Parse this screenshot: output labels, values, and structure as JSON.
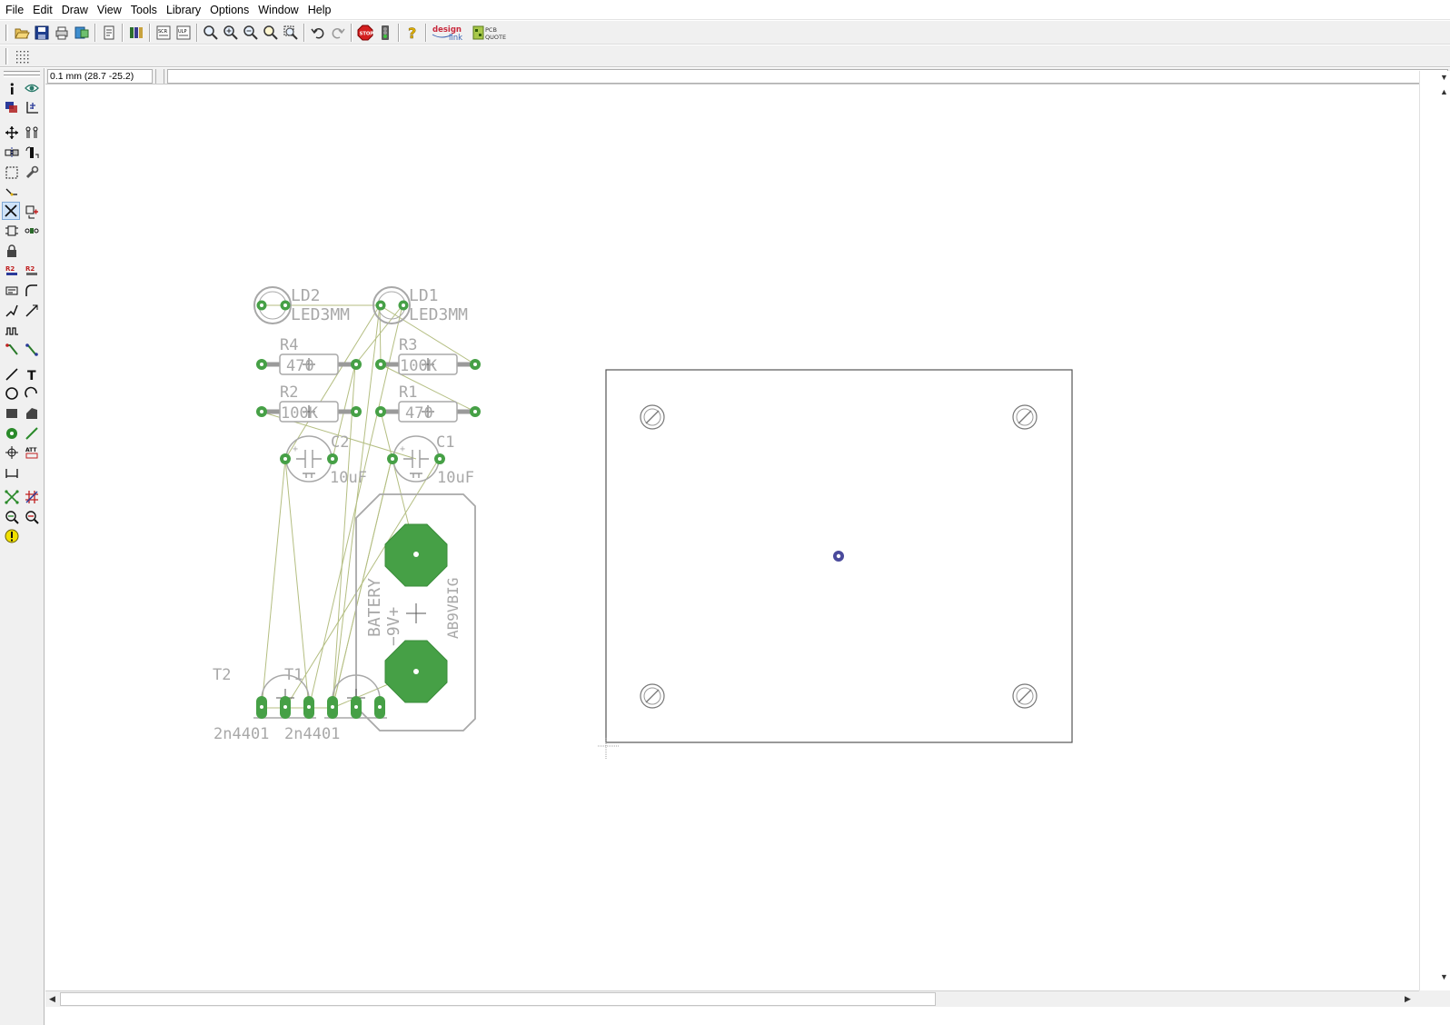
{
  "menu": [
    "File",
    "Edit",
    "Draw",
    "View",
    "Tools",
    "Library",
    "Options",
    "Window",
    "Help"
  ],
  "toolbar": {
    "icons": [
      "open-icon",
      "save-icon",
      "print-icon",
      "cam-processor-icon",
      "switch-schematic-icon",
      "library-icon",
      "script-icon",
      "ulp-icon",
      "zoom-fit-icon",
      "zoom-in-icon",
      "zoom-out-icon",
      "zoom-redraw-icon",
      "zoom-area-icon",
      "undo-icon",
      "redo-icon",
      "stop-icon",
      "go-icon",
      "help-icon",
      "designlink-icon",
      "pcb-quote-icon"
    ],
    "designlink_label": [
      "design",
      "link"
    ],
    "pcbquote_label": [
      "PCB",
      "QUOTE"
    ]
  },
  "command": {
    "coordinates": "0.1 mm (28.7 -25.2)",
    "input_value": ""
  },
  "palette": {
    "tools": [
      "info",
      "show",
      "display-layers",
      "mark",
      "move",
      "copy",
      "mirror",
      "rotate",
      "group",
      "change",
      "miter",
      "delete",
      "add",
      "pinswap",
      "replace",
      "lock",
      "name",
      "value",
      "smash",
      "split",
      "optimize",
      "route",
      "ripup",
      "meander",
      "signal",
      "auto-route",
      "line",
      "text",
      "circle",
      "arc",
      "rectangle",
      "polygon",
      "via",
      "hole",
      "attribute",
      "dimension",
      "ratsnest",
      "drc",
      "errors",
      "auto-router-follow",
      "erc"
    ]
  },
  "components": {
    "LD2": {
      "name": "LD2",
      "value": "LED3MM"
    },
    "LD1": {
      "name": "LD1",
      "value": "LED3MM"
    },
    "R4": {
      "name": "R4",
      "value": "470"
    },
    "R3": {
      "name": "R3",
      "value": "100K"
    },
    "R2": {
      "name": "R2",
      "value": "100K"
    },
    "R1": {
      "name": "R1",
      "value": "470"
    },
    "C2": {
      "name": "C2",
      "value": "10uF"
    },
    "C1": {
      "name": "C1",
      "value": "10uF"
    },
    "T2": {
      "name": "T2",
      "value": "2n4401"
    },
    "T1": {
      "name": "T1",
      "value": "2n4401"
    },
    "battery": {
      "name": "BATERY",
      "voltage": "−9V+",
      "value": "AB9VBIG"
    }
  },
  "colors": {
    "pad": "#46a046",
    "pad_dark": "#2e7d2e",
    "ratsnest": "#b4be82",
    "silk": "#a8a8a8",
    "board_outline": "#555555",
    "via": "#4a4a9c"
  }
}
